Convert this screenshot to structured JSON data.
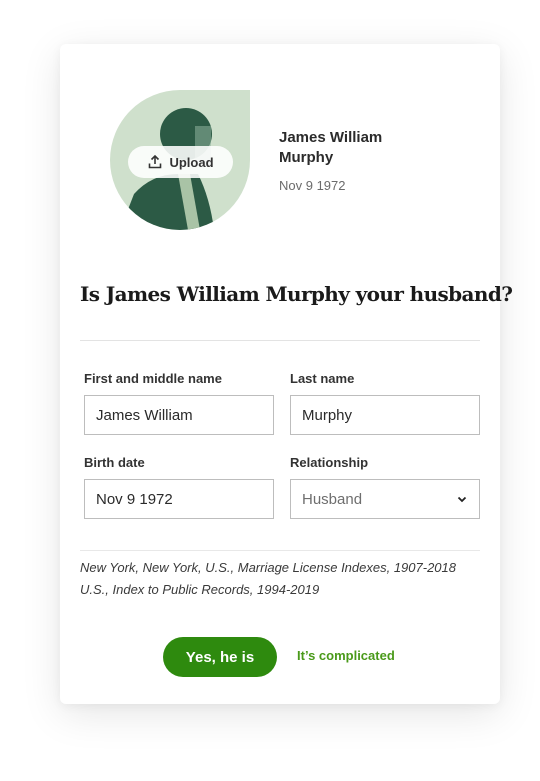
{
  "profile": {
    "upload_label": "Upload",
    "name": "James William Murphy",
    "birth_date": "Nov 9 1972",
    "avatar_icon": "person-silhouette-icon",
    "upload_icon": "upload-icon"
  },
  "question": "Is James William Murphy your husband?",
  "form": {
    "first_name": {
      "label": "First and middle name",
      "value": "James William"
    },
    "last_name": {
      "label": "Last name",
      "value": "Murphy"
    },
    "birth_date": {
      "label": "Birth date",
      "value": "Nov 9 1972"
    },
    "relationship": {
      "label": "Relationship",
      "value": "Husband",
      "icon": "chevron-down-icon"
    }
  },
  "sources": [
    "New York, New York, U.S., Marriage License Indexes, 1907-2018",
    "U.S., Index to Public Records, 1994-2019"
  ],
  "actions": {
    "confirm_label": "Yes, he is",
    "alternate_label": "It’s complicated"
  },
  "colors": {
    "primary_green": "#2e8a0e",
    "link_green": "#4a9a1a",
    "avatar_bg": "#cfe0cc",
    "avatar_dark": "#2c5a45"
  }
}
